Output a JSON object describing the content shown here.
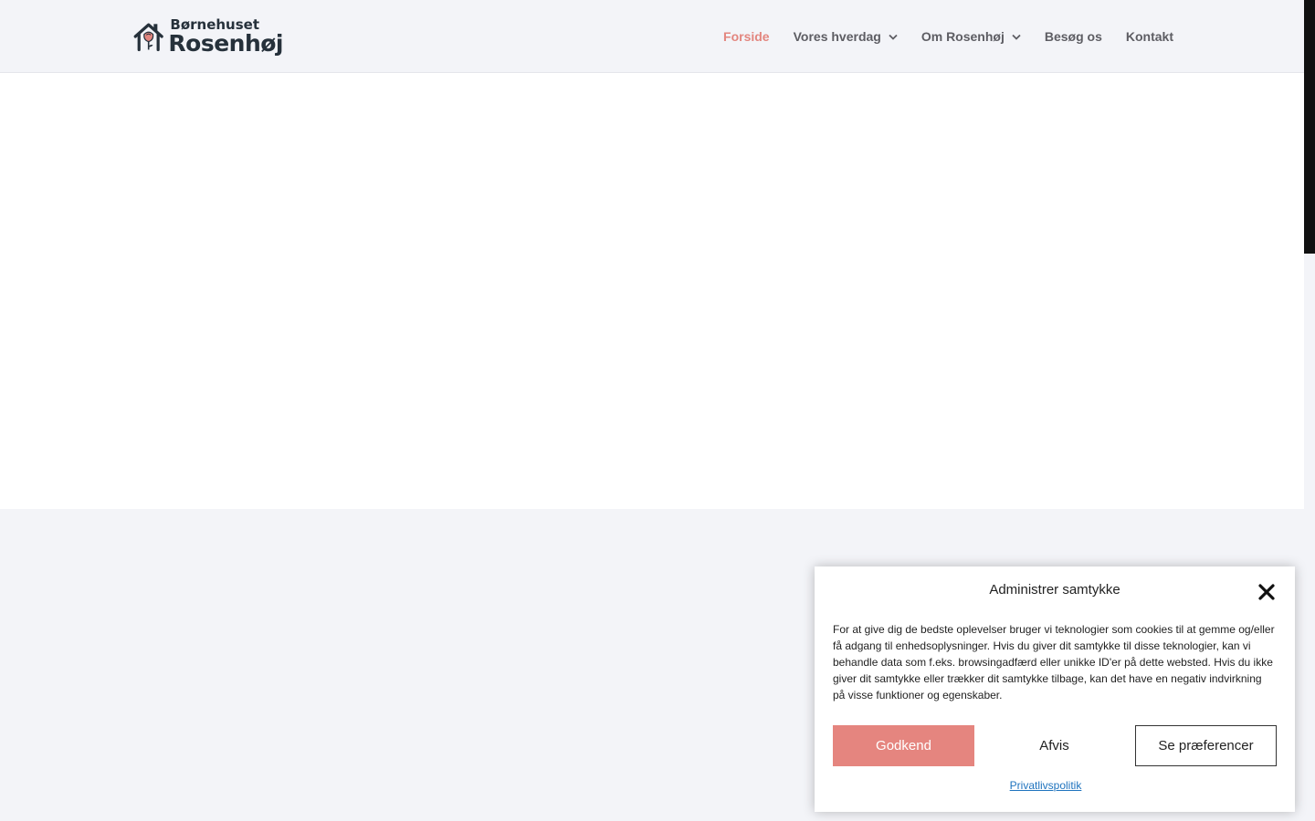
{
  "header": {
    "logo": {
      "top_text": "Børnehuset",
      "main_text": "Rosenhøj",
      "icon": "house-rose-icon"
    },
    "nav": [
      {
        "label": "Forside",
        "active": true,
        "has_dropdown": false
      },
      {
        "label": "Vores hverdag",
        "active": false,
        "has_dropdown": true
      },
      {
        "label": "Om Rosenhøj",
        "active": false,
        "has_dropdown": true
      },
      {
        "label": "Besøg os",
        "active": false,
        "has_dropdown": false
      },
      {
        "label": "Kontakt",
        "active": false,
        "has_dropdown": false
      }
    ]
  },
  "consent": {
    "title": "Administrer samtykke",
    "body": "For at give dig de bedste oplevelser bruger vi teknologier som cookies til at gemme og/eller få adgang til enhedsoplysninger. Hvis du giver dit samtykke til disse teknologier, kan vi behandle data som f.eks. browsingadfærd eller unikke ID'er på dette websted. Hvis du ikke giver dit samtykke eller trækker dit samtykke tilbage, kan det have en negativ indvirkning på visse funktioner og egenskaber.",
    "accept_label": "Godkend",
    "deny_label": "Afvis",
    "prefs_label": "Se præferencer",
    "privacy_link": "Privatlivspolitik"
  },
  "colors": {
    "accent": "#e5857f",
    "text_dark": "#26313b",
    "nav_text": "#5d5d63",
    "link": "#1e73be",
    "page_bg": "#f3f4f8"
  }
}
